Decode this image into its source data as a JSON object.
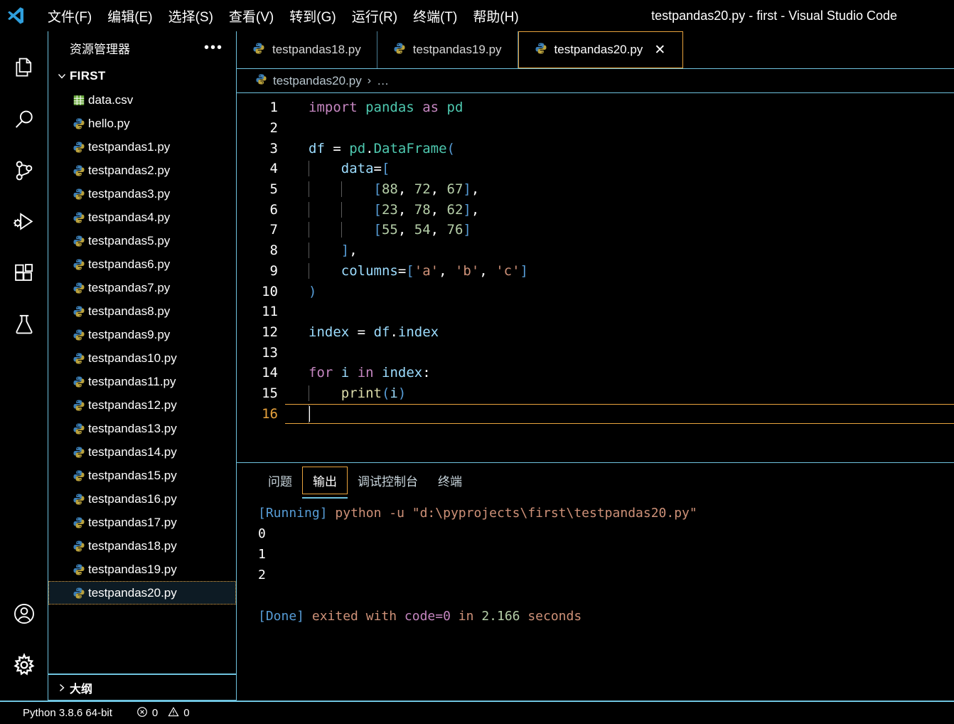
{
  "titlebar": {
    "window_title": "testpandas20.py - first - Visual Studio Code",
    "logo_icon": "vscode-logo-icon",
    "menu": [
      {
        "label": "文件(F)",
        "name": "menu-file"
      },
      {
        "label": "编辑(E)",
        "name": "menu-edit"
      },
      {
        "label": "选择(S)",
        "name": "menu-selection"
      },
      {
        "label": "查看(V)",
        "name": "menu-view"
      },
      {
        "label": "转到(G)",
        "name": "menu-go"
      },
      {
        "label": "运行(R)",
        "name": "menu-run"
      },
      {
        "label": "终端(T)",
        "name": "menu-terminal"
      },
      {
        "label": "帮助(H)",
        "name": "menu-help"
      }
    ]
  },
  "activitybar": {
    "items": [
      {
        "icon": "files-explorer-icon",
        "active": true
      },
      {
        "icon": "search-icon",
        "active": false
      },
      {
        "icon": "source-control-icon",
        "active": false
      },
      {
        "icon": "run-and-debug-icon",
        "active": false
      },
      {
        "icon": "extensions-icon",
        "active": false
      },
      {
        "icon": "testing-beaker-icon",
        "active": false
      }
    ],
    "bottom_items": [
      {
        "icon": "accounts-icon"
      },
      {
        "icon": "manage-gear-icon"
      }
    ]
  },
  "sidebar": {
    "title": "资源管理器",
    "more_actions": "•••",
    "folder": {
      "name": "FIRST",
      "expanded": true
    },
    "files": [
      {
        "label": "data.csv",
        "icon": "csv-file-icon",
        "selected": false
      },
      {
        "label": "hello.py",
        "icon": "python-file-icon",
        "selected": false
      },
      {
        "label": "testpandas1.py",
        "icon": "python-file-icon",
        "selected": false
      },
      {
        "label": "testpandas2.py",
        "icon": "python-file-icon",
        "selected": false
      },
      {
        "label": "testpandas3.py",
        "icon": "python-file-icon",
        "selected": false
      },
      {
        "label": "testpandas4.py",
        "icon": "python-file-icon",
        "selected": false
      },
      {
        "label": "testpandas5.py",
        "icon": "python-file-icon",
        "selected": false
      },
      {
        "label": "testpandas6.py",
        "icon": "python-file-icon",
        "selected": false
      },
      {
        "label": "testpandas7.py",
        "icon": "python-file-icon",
        "selected": false
      },
      {
        "label": "testpandas8.py",
        "icon": "python-file-icon",
        "selected": false
      },
      {
        "label": "testpandas9.py",
        "icon": "python-file-icon",
        "selected": false
      },
      {
        "label": "testpandas10.py",
        "icon": "python-file-icon",
        "selected": false
      },
      {
        "label": "testpandas11.py",
        "icon": "python-file-icon",
        "selected": false
      },
      {
        "label": "testpandas12.py",
        "icon": "python-file-icon",
        "selected": false
      },
      {
        "label": "testpandas13.py",
        "icon": "python-file-icon",
        "selected": false
      },
      {
        "label": "testpandas14.py",
        "icon": "python-file-icon",
        "selected": false
      },
      {
        "label": "testpandas15.py",
        "icon": "python-file-icon",
        "selected": false
      },
      {
        "label": "testpandas16.py",
        "icon": "python-file-icon",
        "selected": false
      },
      {
        "label": "testpandas17.py",
        "icon": "python-file-icon",
        "selected": false
      },
      {
        "label": "testpandas18.py",
        "icon": "python-file-icon",
        "selected": false
      },
      {
        "label": "testpandas19.py",
        "icon": "python-file-icon",
        "selected": false
      },
      {
        "label": "testpandas20.py",
        "icon": "python-file-icon",
        "selected": true
      }
    ],
    "outline": {
      "label": "大纲",
      "expanded": false
    }
  },
  "editor": {
    "tabs": [
      {
        "label": "testpandas18.py",
        "icon": "python-file-icon",
        "active": false,
        "closable": false
      },
      {
        "label": "testpandas19.py",
        "icon": "python-file-icon",
        "active": false,
        "closable": false
      },
      {
        "label": "testpandas20.py",
        "icon": "python-file-icon",
        "active": true,
        "closable": true,
        "close_label": "✕"
      }
    ],
    "breadcrumb": {
      "file": "testpandas20.py",
      "separator": "›",
      "dots": "…",
      "icon": "python-file-icon"
    },
    "active_line": 16,
    "lines": [
      {
        "n": "1",
        "tokens": [
          [
            "t-kw",
            "import"
          ],
          [
            "t-punct",
            " "
          ],
          [
            "t-mod",
            "pandas"
          ],
          [
            "t-punct",
            " "
          ],
          [
            "t-kw",
            "as"
          ],
          [
            "t-punct",
            " "
          ],
          [
            "t-mod",
            "pd"
          ]
        ]
      },
      {
        "n": "2",
        "tokens": []
      },
      {
        "n": "3",
        "tokens": [
          [
            "t-var",
            "df"
          ],
          [
            "t-punct",
            " "
          ],
          [
            "t-op",
            "="
          ],
          [
            "t-punct",
            " "
          ],
          [
            "t-mod",
            "pd"
          ],
          [
            "t-punct",
            "."
          ],
          [
            "t-mod",
            "DataFrame"
          ],
          [
            "t-blue",
            "("
          ]
        ]
      },
      {
        "n": "4",
        "tokens": [
          [
            "t-punct",
            "    "
          ],
          [
            "t-var",
            "data"
          ],
          [
            "t-op",
            "="
          ],
          [
            "t-blue",
            "["
          ]
        ]
      },
      {
        "n": "5",
        "tokens": [
          [
            "t-punct",
            "        "
          ],
          [
            "t-blue",
            "["
          ],
          [
            "t-num",
            "88"
          ],
          [
            "t-punct",
            ", "
          ],
          [
            "t-num",
            "72"
          ],
          [
            "t-punct",
            ", "
          ],
          [
            "t-num",
            "67"
          ],
          [
            "t-blue",
            "]"
          ],
          [
            "t-punct",
            ","
          ]
        ]
      },
      {
        "n": "6",
        "tokens": [
          [
            "t-punct",
            "        "
          ],
          [
            "t-blue",
            "["
          ],
          [
            "t-num",
            "23"
          ],
          [
            "t-punct",
            ", "
          ],
          [
            "t-num",
            "78"
          ],
          [
            "t-punct",
            ", "
          ],
          [
            "t-num",
            "62"
          ],
          [
            "t-blue",
            "]"
          ],
          [
            "t-punct",
            ","
          ]
        ]
      },
      {
        "n": "7",
        "tokens": [
          [
            "t-punct",
            "        "
          ],
          [
            "t-blue",
            "["
          ],
          [
            "t-num",
            "55"
          ],
          [
            "t-punct",
            ", "
          ],
          [
            "t-num",
            "54"
          ],
          [
            "t-punct",
            ", "
          ],
          [
            "t-num",
            "76"
          ],
          [
            "t-blue",
            "]"
          ]
        ]
      },
      {
        "n": "8",
        "tokens": [
          [
            "t-punct",
            "    "
          ],
          [
            "t-blue",
            "]"
          ],
          [
            "t-punct",
            ","
          ]
        ]
      },
      {
        "n": "9",
        "tokens": [
          [
            "t-punct",
            "    "
          ],
          [
            "t-var",
            "columns"
          ],
          [
            "t-op",
            "="
          ],
          [
            "t-blue",
            "["
          ],
          [
            "t-str",
            "'a'"
          ],
          [
            "t-punct",
            ", "
          ],
          [
            "t-str",
            "'b'"
          ],
          [
            "t-punct",
            ", "
          ],
          [
            "t-str",
            "'c'"
          ],
          [
            "t-blue",
            "]"
          ]
        ]
      },
      {
        "n": "10",
        "tokens": [
          [
            "t-blue",
            ")"
          ]
        ]
      },
      {
        "n": "11",
        "tokens": []
      },
      {
        "n": "12",
        "tokens": [
          [
            "t-var",
            "index"
          ],
          [
            "t-punct",
            " "
          ],
          [
            "t-op",
            "="
          ],
          [
            "t-punct",
            " "
          ],
          [
            "t-var",
            "df"
          ],
          [
            "t-punct",
            "."
          ],
          [
            "t-var",
            "index"
          ]
        ]
      },
      {
        "n": "13",
        "tokens": []
      },
      {
        "n": "14",
        "tokens": [
          [
            "t-kw",
            "for"
          ],
          [
            "t-punct",
            " "
          ],
          [
            "t-var",
            "i"
          ],
          [
            "t-punct",
            " "
          ],
          [
            "t-kw",
            "in"
          ],
          [
            "t-punct",
            " "
          ],
          [
            "t-var",
            "index"
          ],
          [
            "t-punct",
            ":"
          ]
        ]
      },
      {
        "n": "15",
        "tokens": [
          [
            "t-punct",
            "    "
          ],
          [
            "t-fn",
            "print"
          ],
          [
            "t-blue",
            "("
          ],
          [
            "t-var",
            "i"
          ],
          [
            "t-blue",
            ")"
          ]
        ]
      },
      {
        "n": "16",
        "tokens": []
      }
    ]
  },
  "panel": {
    "tabs": [
      {
        "label": "问题",
        "name": "tab-problems",
        "active": false
      },
      {
        "label": "输出",
        "name": "tab-output",
        "active": true
      },
      {
        "label": "调试控制台",
        "name": "tab-debug-console",
        "active": false
      },
      {
        "label": "终端",
        "name": "tab-terminal",
        "active": false
      }
    ],
    "output_lines": [
      {
        "parts": [
          [
            "o-tag",
            "[Running]"
          ],
          [
            "o-plain",
            " "
          ],
          [
            "o-cmd",
            "python -u \"d:\\pyprojects\\first\\testpandas20.py\""
          ]
        ]
      },
      {
        "parts": [
          [
            "o-plain",
            "0"
          ]
        ]
      },
      {
        "parts": [
          [
            "o-plain",
            "1"
          ]
        ]
      },
      {
        "parts": [
          [
            "o-plain",
            "2"
          ]
        ]
      },
      {
        "parts": [
          [
            "o-plain",
            ""
          ]
        ]
      },
      {
        "parts": [
          [
            "o-tag",
            "[Done]"
          ],
          [
            "o-plain",
            " "
          ],
          [
            "o-cmd",
            "exited with "
          ],
          [
            "o-code",
            "code=0"
          ],
          [
            "o-cmd",
            " in "
          ],
          [
            "o-num",
            "2.166"
          ],
          [
            "o-cmd",
            " seconds"
          ]
        ]
      }
    ]
  },
  "statusbar": {
    "python_version": "Python 3.8.6 64-bit",
    "errors_icon": "error-circle-icon",
    "errors_count": "0",
    "warnings_icon": "warning-triangle-icon",
    "warnings_count": "0"
  },
  "colors": {
    "background": "#000000",
    "border_accent": "#6FC3DF",
    "focus_accent": "#E8A33D",
    "text": "#ffffff",
    "logo_blue": "#0f7ac8"
  }
}
